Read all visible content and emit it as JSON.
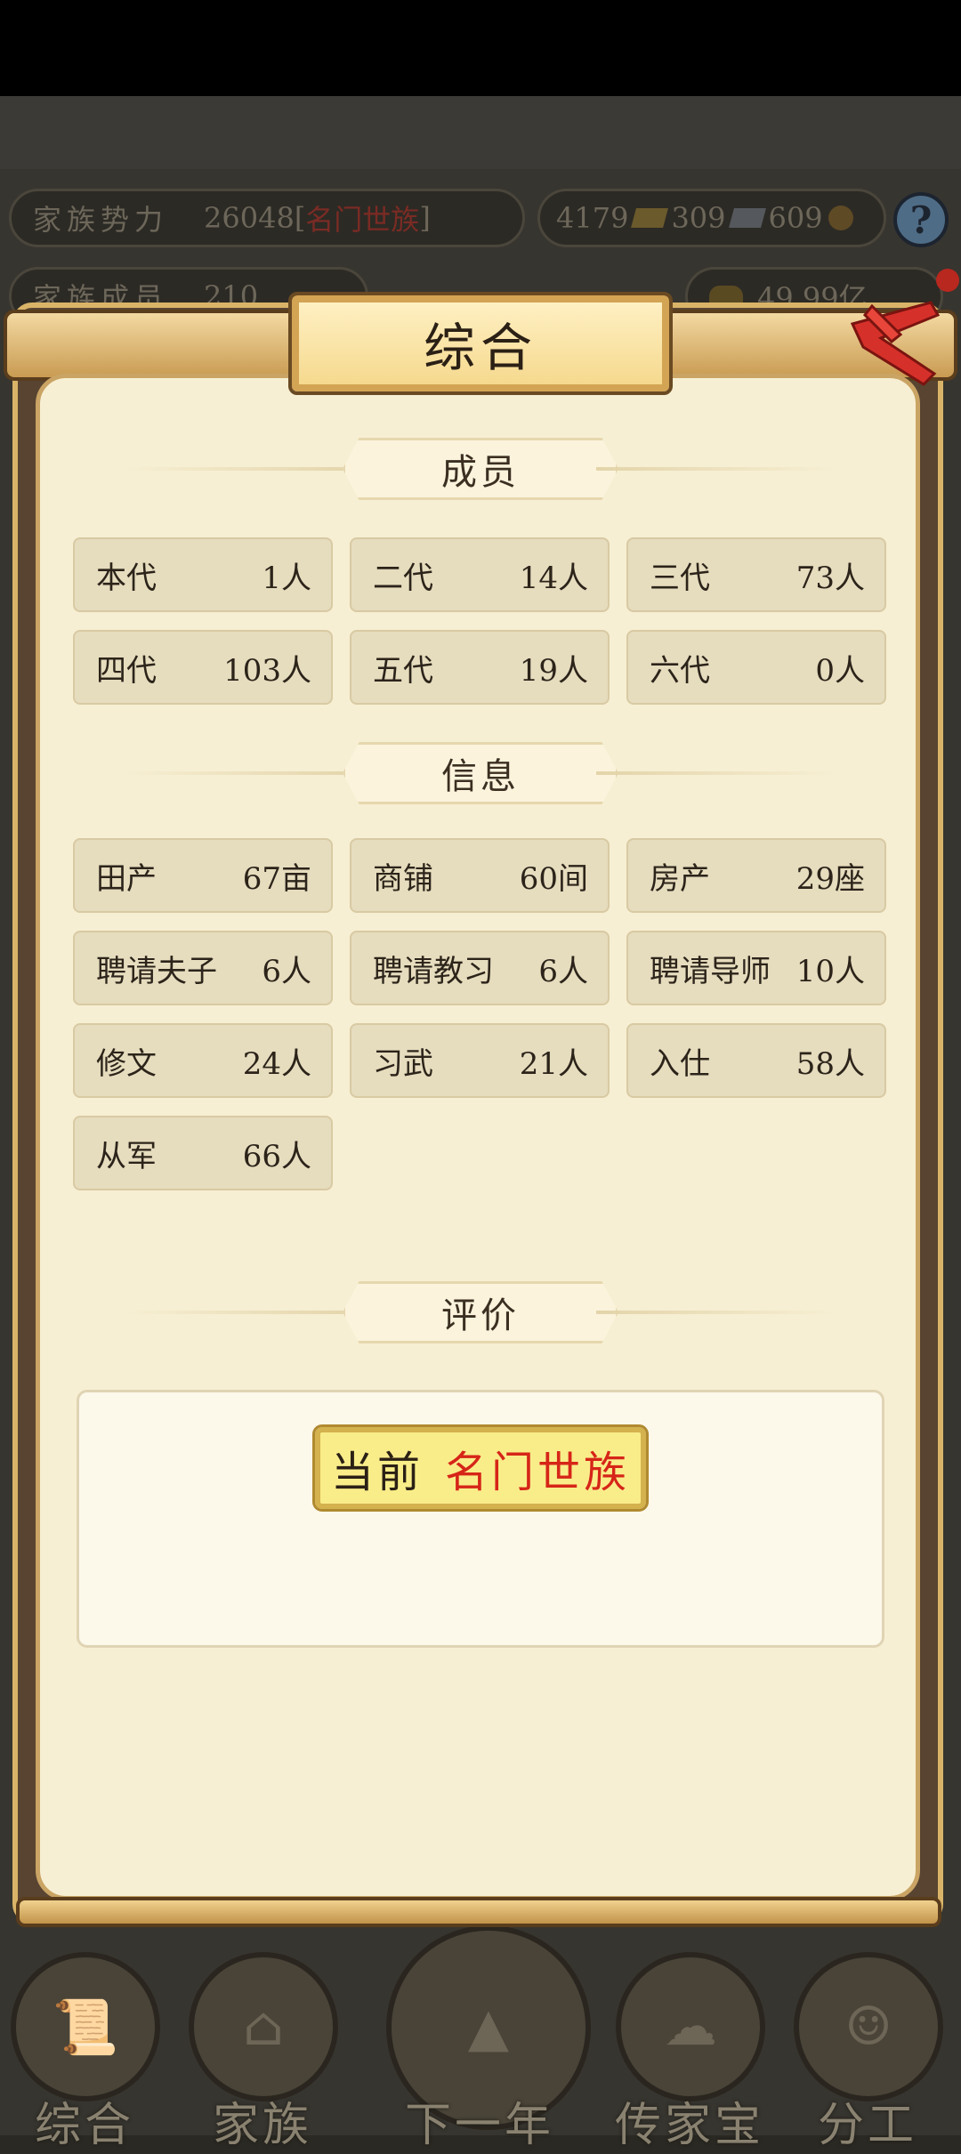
{
  "background": {
    "stats": {
      "power_label": "家族势力",
      "power_value": "26048",
      "power_rank": "名门世族",
      "bracket_open": "[",
      "bracket_close": "]",
      "gold": "4179",
      "silver": "309",
      "coins": "609",
      "members_label": "家族成员",
      "members_value": "210",
      "money": "49.99亿"
    },
    "help_icon": "?"
  },
  "modal": {
    "title": "综合",
    "close_icon": "close-icon",
    "sections": {
      "members": {
        "title": "成员",
        "items": [
          {
            "label": "本代",
            "value": "1人"
          },
          {
            "label": "二代",
            "value": "14人"
          },
          {
            "label": "三代",
            "value": "73人"
          },
          {
            "label": "四代",
            "value": "103人"
          },
          {
            "label": "五代",
            "value": "19人"
          },
          {
            "label": "六代",
            "value": "0人"
          }
        ]
      },
      "info": {
        "title": "信息",
        "items": [
          {
            "label": "田产",
            "value": "67亩"
          },
          {
            "label": "商铺",
            "value": "60间"
          },
          {
            "label": "房产",
            "value": "29座"
          },
          {
            "label": "聘请夫子",
            "value": "6人"
          },
          {
            "label": "聘请教习",
            "value": "6人"
          },
          {
            "label": "聘请导师",
            "value": "10人"
          },
          {
            "label": "修文",
            "value": "24人"
          },
          {
            "label": "习武",
            "value": "21人"
          },
          {
            "label": "入仕",
            "value": "58人"
          },
          {
            "label": "从军",
            "value": "66人"
          }
        ]
      },
      "rating": {
        "title": "评价",
        "prefix": "当前",
        "value": "名门世族"
      }
    }
  },
  "bottom_nav": [
    {
      "label": "综合",
      "icon": "scroll-icon"
    },
    {
      "label": "家族",
      "icon": "house-icon"
    },
    {
      "label": "下一年",
      "icon": "mountain-icon"
    },
    {
      "label": "传家宝",
      "icon": "cloud-icon"
    },
    {
      "label": "分工",
      "icon": "people-icon"
    }
  ],
  "colors": {
    "modal_bg": "#f7efd3",
    "card_bg": "#e6dcbe",
    "rating_red": "#d62518",
    "gold_border": "#d9b468"
  }
}
